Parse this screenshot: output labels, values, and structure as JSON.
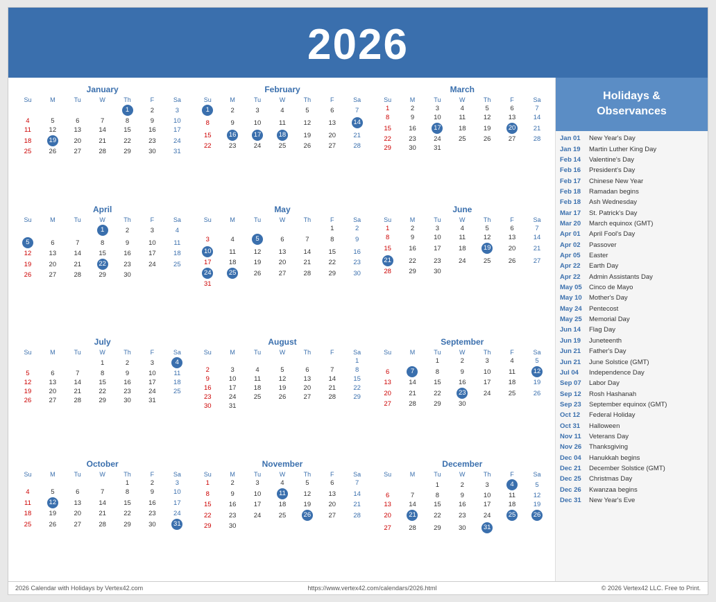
{
  "banner": {
    "year": "2026"
  },
  "holidays_header": "Holidays &\nObservances",
  "holidays": [
    {
      "date": "Jan 01",
      "name": "New Year's Day"
    },
    {
      "date": "Jan 19",
      "name": "Martin Luther King Day"
    },
    {
      "date": "Feb 14",
      "name": "Valentine's Day"
    },
    {
      "date": "Feb 16",
      "name": "President's Day"
    },
    {
      "date": "Feb 17",
      "name": "Chinese New Year"
    },
    {
      "date": "Feb 18",
      "name": "Ramadan begins"
    },
    {
      "date": "Feb 18",
      "name": "Ash Wednesday"
    },
    {
      "date": "Mar 17",
      "name": "St. Patrick's Day"
    },
    {
      "date": "Mar 20",
      "name": "March equinox (GMT)"
    },
    {
      "date": "Apr 01",
      "name": "April Fool's Day"
    },
    {
      "date": "Apr 02",
      "name": "Passover"
    },
    {
      "date": "Apr 05",
      "name": "Easter"
    },
    {
      "date": "Apr 22",
      "name": "Earth Day"
    },
    {
      "date": "Apr 22",
      "name": "Admin Assistants Day"
    },
    {
      "date": "May 05",
      "name": "Cinco de Mayo"
    },
    {
      "date": "May 10",
      "name": "Mother's Day"
    },
    {
      "date": "May 24",
      "name": "Pentecost"
    },
    {
      "date": "May 25",
      "name": "Memorial Day"
    },
    {
      "date": "Jun 14",
      "name": "Flag Day"
    },
    {
      "date": "Jun 19",
      "name": "Juneteenth"
    },
    {
      "date": "Jun 21",
      "name": "Father's Day"
    },
    {
      "date": "Jun 21",
      "name": "June Solstice (GMT)"
    },
    {
      "date": "Jul 04",
      "name": "Independence Day"
    },
    {
      "date": "Sep 07",
      "name": "Labor Day"
    },
    {
      "date": "Sep 12",
      "name": "Rosh Hashanah"
    },
    {
      "date": "Sep 23",
      "name": "September equinox (GMT)"
    },
    {
      "date": "Oct 12",
      "name": "Federal Holiday"
    },
    {
      "date": "Oct 31",
      "name": "Halloween"
    },
    {
      "date": "Nov 11",
      "name": "Veterans Day"
    },
    {
      "date": "Nov 26",
      "name": "Thanksgiving"
    },
    {
      "date": "Dec 04",
      "name": "Hanukkah begins"
    },
    {
      "date": "Dec 21",
      "name": "December Solstice (GMT)"
    },
    {
      "date": "Dec 25",
      "name": "Christmas Day"
    },
    {
      "date": "Dec 26",
      "name": "Kwanzaa begins"
    },
    {
      "date": "Dec 31",
      "name": "New Year's Eve"
    }
  ],
  "footer": {
    "left": "2026 Calendar with Holidays by Vertex42.com",
    "center": "https://www.vertex42.com/calendars/2026.html",
    "right": "© 2026 Vertex42 LLC. Free to Print."
  }
}
